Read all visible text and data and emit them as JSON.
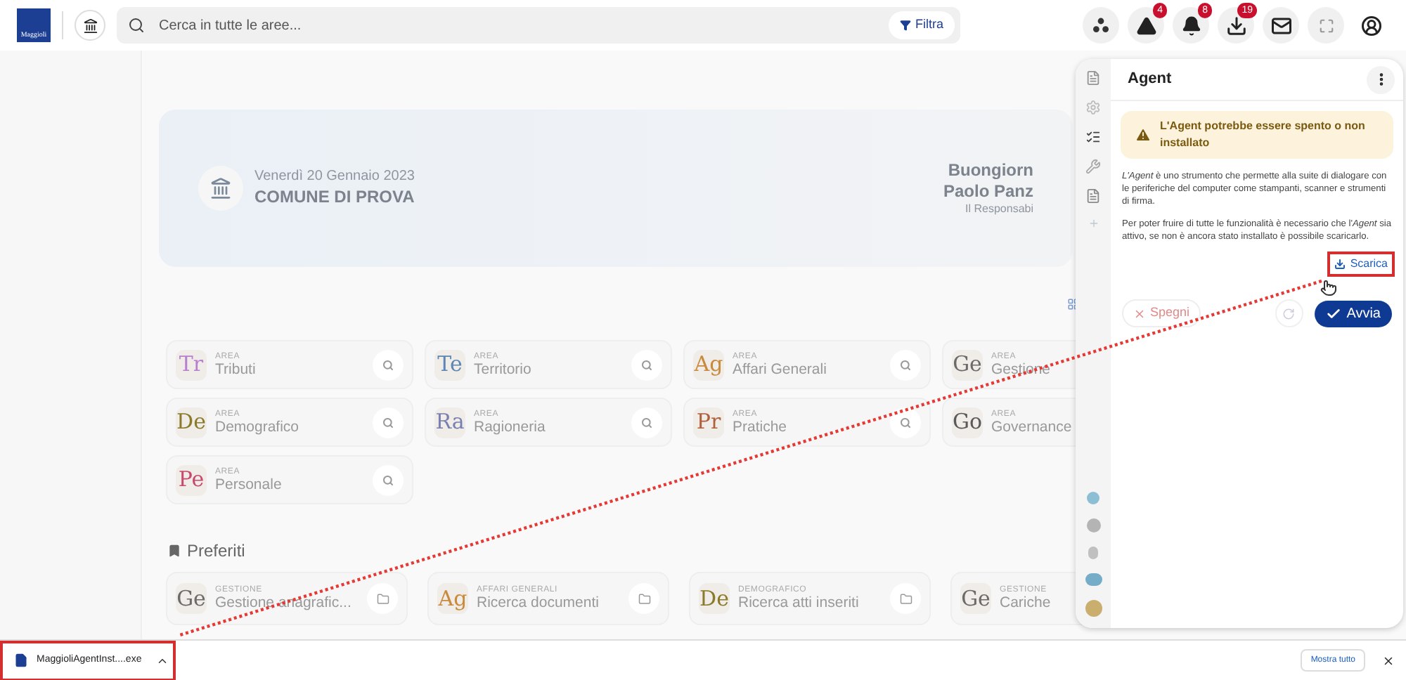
{
  "topbar": {
    "brand": "Maggioli",
    "search": {
      "placeholder": "Cerca in tutte le aree..."
    },
    "filter_button": "Filtra",
    "actions": [
      {
        "kind": "apps"
      },
      {
        "kind": "warning",
        "count": "4"
      },
      {
        "kind": "bell",
        "count": "8"
      },
      {
        "kind": "download",
        "count": "19"
      },
      {
        "kind": "mail"
      },
      {
        "kind": "fullscreen"
      },
      {
        "kind": "account"
      }
    ]
  },
  "banner": {
    "date": "Venerdì 20 Gennaio 2023",
    "entity": "COMUNE DI PROVA",
    "greeting": "Buongiorn",
    "user": "Paolo Panz",
    "role": "Il Responsabi"
  },
  "areas": [
    {
      "code": "Tr",
      "label": "AREA",
      "name": "Tributi",
      "color": "#b77fcf"
    },
    {
      "code": "Te",
      "label": "AREA",
      "name": "Territorio",
      "color": "#5b86b5"
    },
    {
      "code": "Ag",
      "label": "AREA",
      "name": "Affari Generali",
      "color": "#c98a3c"
    },
    {
      "code": "Ge",
      "label": "AREA",
      "name": "Gestione",
      "color": "#6b6b6b"
    },
    {
      "code": "De",
      "label": "AREA",
      "name": "Demografico",
      "color": "#8a7a2a"
    },
    {
      "code": "Ra",
      "label": "AREA",
      "name": "Ragioneria",
      "color": "#7a7fb3"
    },
    {
      "code": "Pr",
      "label": "AREA",
      "name": "Pratiche",
      "color": "#b0603a"
    },
    {
      "code": "Go",
      "label": "AREA",
      "name": "Governance",
      "color": "#5a5a5a"
    },
    {
      "code": "Pe",
      "label": "AREA",
      "name": "Personale",
      "color": "#c84a6a"
    }
  ],
  "favorites": {
    "title": "Preferiti",
    "items": [
      {
        "code": "Ge",
        "category": "GESTIONE",
        "name": "Gestione anagrafic...",
        "color": "#6b6b6b"
      },
      {
        "code": "Ag",
        "category": "AFFARI GENERALI",
        "name": "Ricerca documenti",
        "color": "#c98a3c"
      },
      {
        "code": "De",
        "category": "DEMOGRAFICO",
        "name": "Ricerca atti inseriti",
        "color": "#8a7a2a"
      },
      {
        "code": "Ge",
        "category": "GESTIONE",
        "name": "Cariche",
        "color": "#6b6b6b"
      }
    ]
  },
  "agent_panel": {
    "title": "Agent",
    "warning": "L'Agent potrebbe essere spento o non installato",
    "paragraphs": [
      "*L'Agent* è uno strumento che permette alla suite di dialogare con le periferiche del computer come stampanti, scanner e strumenti di firma.",
      "Per poter fruire di tutte le funzionalità è necessario che l'*Agent* sia attivo, se non è ancora stato installato è possibile scaricarlo."
    ],
    "download_link": "Scarica",
    "stop_button": {
      "label": "Spegni",
      "disabled": true
    },
    "refresh_disabled": true,
    "start_button": {
      "label": "Avvia",
      "disabled": false
    }
  },
  "download_bar": {
    "file": "MaggioliAgentInst....exe",
    "show_all": "Mostra tutto"
  }
}
